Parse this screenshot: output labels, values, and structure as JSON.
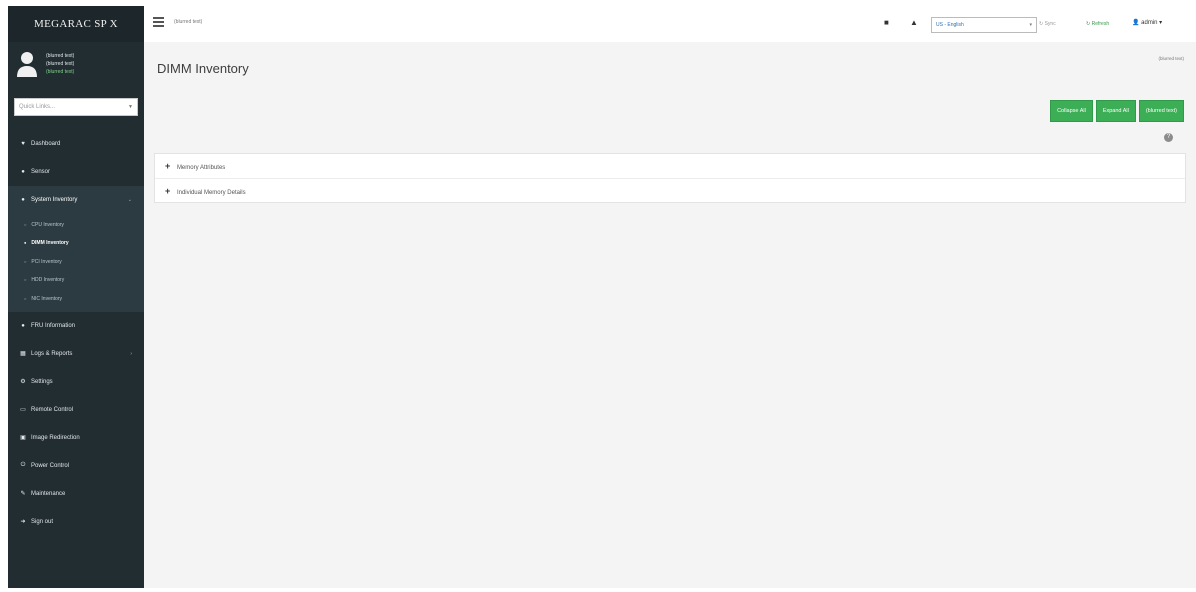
{
  "brand": "MEGARAC SP X",
  "user": {
    "name": "(blurred text)",
    "line2": "(blurred text)",
    "status": "(blurred text)"
  },
  "quick_links": {
    "placeholder": "Quick Links..."
  },
  "menu": [
    {
      "label": "Dashboard",
      "icon": "dashboard-icon"
    },
    {
      "label": "Sensor",
      "icon": "sensor-icon"
    },
    {
      "label": "System Inventory",
      "icon": "inventory-icon",
      "expanded": true
    },
    {
      "label": "FRU Information",
      "icon": "info-icon"
    },
    {
      "label": "Logs & Reports",
      "icon": "chart-icon",
      "has_children": true
    },
    {
      "label": "Settings",
      "icon": "gear-icon"
    },
    {
      "label": "Remote Control",
      "icon": "monitor-icon"
    },
    {
      "label": "Image Redirection",
      "icon": "image-icon"
    },
    {
      "label": "Power Control",
      "icon": "power-icon"
    },
    {
      "label": "Maintenance",
      "icon": "wrench-icon"
    },
    {
      "label": "Sign out",
      "icon": "signout-icon"
    }
  ],
  "submenu": [
    {
      "label": "CPU Inventory"
    },
    {
      "label": "DIMM Inventory",
      "current": true
    },
    {
      "label": "PCI Inventory"
    },
    {
      "label": "HDD Inventory"
    },
    {
      "label": "NIC Inventory"
    }
  ],
  "topbar": {
    "datetime": "(blurred text)",
    "language": "US - English",
    "sync": "Sync",
    "refresh": "Refresh",
    "user": "admin"
  },
  "page": {
    "title": "DIMM Inventory",
    "breadcrumb": "(blurred text)"
  },
  "buttons": {
    "collapse_all": "Collapse All",
    "expand_all": "Expand All",
    "third": "(blurred text)"
  },
  "sections": [
    {
      "label": "Memory Attributes"
    },
    {
      "label": "Individual Memory Details"
    }
  ],
  "colors": {
    "sidebar_bg": "#222d32",
    "accent_green": "#3cae55",
    "content_bg": "#f4f4f4"
  }
}
